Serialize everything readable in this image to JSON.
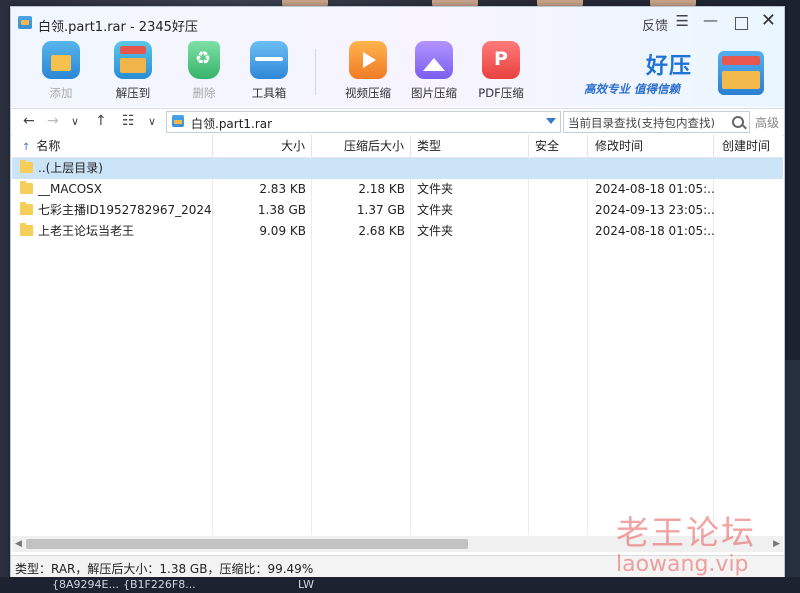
{
  "window": {
    "title": "白领.part1.rar - 2345好压",
    "feedback_label": "反馈",
    "menu_glyph": "☰",
    "minimize_glyph": "—",
    "close_glyph": "✕"
  },
  "toolbar": {
    "add_label": "添加",
    "extract_label": "解压到",
    "delete_label": "删除",
    "toolbox_label": "工具箱",
    "video_label": "视频压缩",
    "image_label": "图片压缩",
    "pdf_label": "PDF压缩"
  },
  "brand": {
    "name": "好压",
    "slogan": "高效专业  值得信赖"
  },
  "nav": {
    "back_glyph": "←",
    "forward_glyph": "→",
    "down_glyph": "∨",
    "up_glyph": "↑",
    "view_glyph": "☷",
    "view_dd_glyph": "∨",
    "path": "白领.part1.rar",
    "search_placeholder": "当前目录查找(支持包内查找)",
    "advanced_label": "高级"
  },
  "columns": {
    "sort_glyph": "↑",
    "name": "名称",
    "size": "大小",
    "compressed_size": "压缩后大小",
    "type": "类型",
    "security": "安全",
    "modified": "修改时间",
    "created": "创建时间"
  },
  "rows": [
    {
      "name": "..(上层目录)",
      "size": "",
      "compressed_size": "",
      "type": "",
      "security": "",
      "modified": "",
      "created": ""
    },
    {
      "name": "__MACOSX",
      "size": "2.83 KB",
      "compressed_size": "2.18 KB",
      "type": "文件夹",
      "security": "",
      "modified": "2024-08-18 01:05:...",
      "created": ""
    },
    {
      "name": "七彩主播ID1952782967_2024...",
      "size": "1.38 GB",
      "compressed_size": "1.37 GB",
      "type": "文件夹",
      "security": "",
      "modified": "2024-09-13 23:05:...",
      "created": ""
    },
    {
      "name": "上老王论坛当老王",
      "size": "9.09 KB",
      "compressed_size": "2.68 KB",
      "type": "文件夹",
      "security": "",
      "modified": "2024-08-18 01:05:...",
      "created": ""
    }
  ],
  "status": {
    "text": "类型：RAR，解压后大小：1.38 GB，压缩比：99.49%"
  },
  "taskbar": {
    "item1": "{8A9294E...",
    "item2": "{B1F226F8...",
    "item3": "LW"
  },
  "watermark": {
    "cn": "老王论坛",
    "url": "laowang.vip"
  },
  "colors": {
    "accent": "#1f73d6",
    "selection": "#cce4f7",
    "watermark": "#e85858"
  }
}
